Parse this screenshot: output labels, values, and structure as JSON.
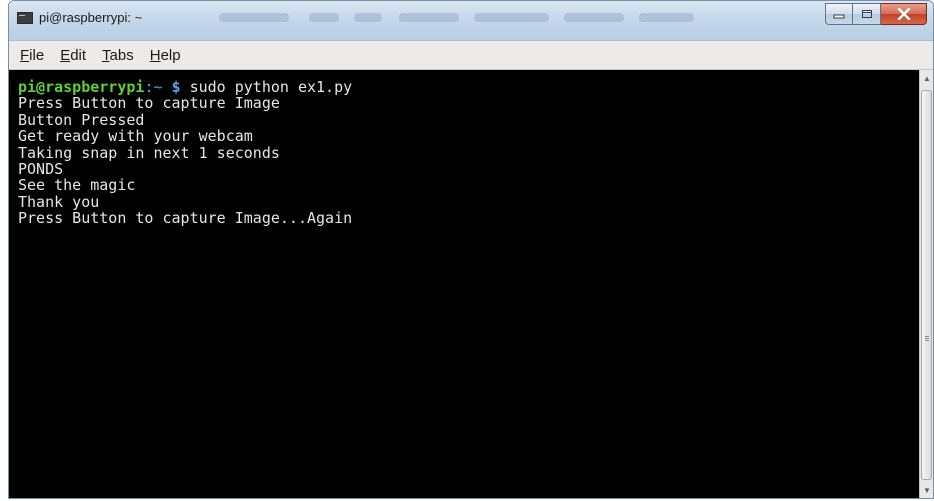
{
  "window": {
    "title": "pi@raspberrypi: ~"
  },
  "colors": {
    "terminal_background": "#000000",
    "terminal_text": "#e6e6e6",
    "prompt_user": "#5ed034",
    "prompt_path": "#5aa0e6"
  },
  "icons": {
    "app": "terminal-icon",
    "minimize": "minimize-icon",
    "maximize": "maximize-icon",
    "close": "close-icon"
  },
  "menu": {
    "file": {
      "label": "File",
      "mnemonic": "F",
      "rest": "ile"
    },
    "edit": {
      "label": "Edit",
      "mnemonic": "E",
      "rest": "dit"
    },
    "tabs": {
      "label": "Tabs",
      "mnemonic": "T",
      "rest": "abs"
    },
    "help": {
      "label": "Help",
      "mnemonic": "H",
      "rest": "elp"
    }
  },
  "terminal": {
    "prompt_user": "pi@raspberrypi",
    "prompt_sep": ":",
    "prompt_path": "~",
    "prompt_sign": "$",
    "command": "sudo python ex1.py",
    "output": [
      "Press Button to capture Image",
      "Button Pressed",
      "Get ready with your webcam",
      "Taking snap in next 1 seconds",
      "PONDS",
      "See the magic",
      "Thank you",
      "Press Button to capture Image...Again"
    ]
  }
}
